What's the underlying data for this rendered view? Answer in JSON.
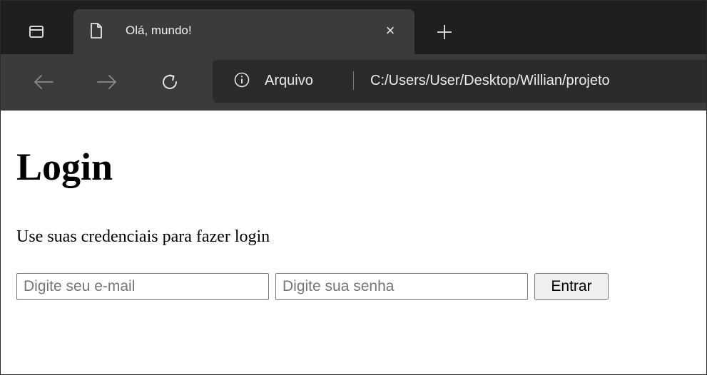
{
  "browser": {
    "tab": {
      "title": "Olá, mundo!",
      "close_symbol": "×"
    },
    "new_tab_symbol": "+",
    "address_bar": {
      "scheme_label": "Arquivo",
      "url": "C:/Users/User/Desktop/Willian/projeto"
    },
    "icons": {
      "tab_actions": "tab-actions-icon",
      "page": "page-icon",
      "back": "back-arrow-icon",
      "forward": "forward-arrow-icon",
      "reload": "reload-icon",
      "info": "info-icon"
    },
    "colors": {
      "tabstrip": "#1f1f1f",
      "toolbar": "#3b3b3b",
      "omnibox": "#2b2b2b"
    }
  },
  "page": {
    "heading": "Login",
    "subtitle": "Use suas credenciais para fazer login",
    "form": {
      "email_placeholder": "Digite seu e-mail",
      "email_value": "",
      "password_placeholder": "Digite sua senha",
      "password_value": "",
      "submit_label": "Entrar"
    }
  }
}
